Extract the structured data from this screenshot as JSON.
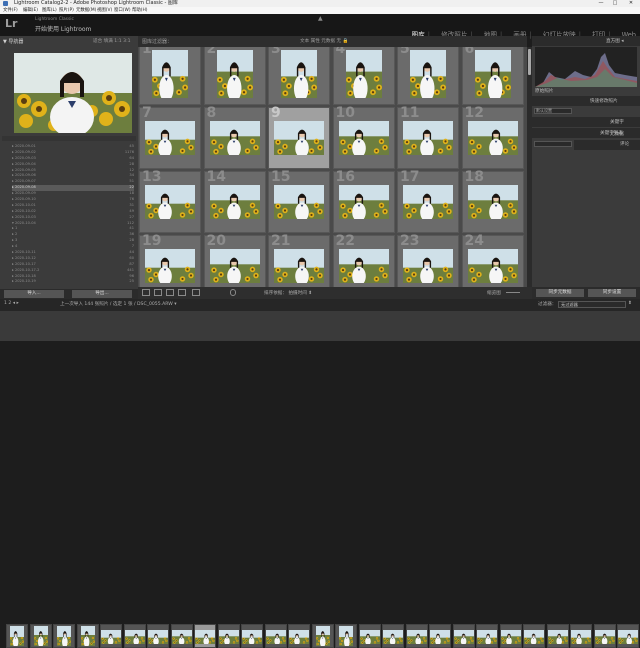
{
  "window": {
    "title": "Lightroom Catalog2-2 - Adobe Photoshop Lightroom Classic - 图库",
    "minimize": "—",
    "maximize": "□",
    "close": "✕"
  },
  "menu": [
    "文件(F)",
    "编辑(E)",
    "图库(L)",
    "照片(P)",
    "元数据(M)",
    "视图(V)",
    "窗口(W)",
    "帮助(H)"
  ],
  "identity": {
    "logo": "Lr",
    "catalog": "Lightroom Classic",
    "plate": "开始使用 Lightroom",
    "arrow": "▲"
  },
  "modules": [
    "图库",
    "修改照片",
    "地图",
    "画册",
    "幻灯片放映",
    "打印",
    "Web"
  ],
  "active_module": "图库",
  "left_panel": {
    "navigator_title": "▼ 导航器",
    "view_options": "适合  填满  1:1  3:1",
    "folders": [
      {
        "name": "▸ 2020-09-01",
        "count": "45"
      },
      {
        "name": "▸ 2020-09-02",
        "count": "1176"
      },
      {
        "name": "▸ 2020-09-03",
        "count": "64"
      },
      {
        "name": "▸ 2020-09-04",
        "count": "28"
      },
      {
        "name": "▸ 2020-09-05",
        "count": "12"
      },
      {
        "name": "▸ 2020-09-06",
        "count": "34"
      },
      {
        "name": "▸ 2020-09-07",
        "count": "51"
      },
      {
        "name": "▸ 2020-09-08",
        "count": "22"
      },
      {
        "name": "▸ 2020-09-09",
        "count": "18"
      },
      {
        "name": "▸ 2020-09-10",
        "count": "76"
      },
      {
        "name": "▸ 2020-10-01",
        "count": "31"
      },
      {
        "name": "▸ 2020-10-02",
        "count": "49"
      },
      {
        "name": "▸ 2020-10-03",
        "count": "27"
      },
      {
        "name": "▾ 2020-10-04",
        "count": "112"
      },
      {
        "name": "   ▸ 1",
        "count": "41"
      },
      {
        "name": "   ▸ 2",
        "count": "36"
      },
      {
        "name": "   ▸ 3",
        "count": "28"
      },
      {
        "name": "   ▸ 4",
        "count": "7"
      },
      {
        "name": "▸ 2020-10-11",
        "count": "44"
      },
      {
        "name": "▸ 2020-10-12",
        "count": "60"
      },
      {
        "name": "▸ 2020-10-17",
        "count": "87"
      },
      {
        "name": "▸ 2020-10-17-2",
        "count": "441"
      },
      {
        "name": "▸ 2020-10-18",
        "count": "96"
      },
      {
        "name": "▸ 2020-10-19",
        "count": "25"
      }
    ],
    "selected_folder_index": 7,
    "import_button": "导入...",
    "export_button": "导出..."
  },
  "toolbar_top": {
    "filter_title": "图库过滤器：",
    "options": "文本   属性   元数据   无  🔒"
  },
  "grid": {
    "numbers": [
      "1",
      "2",
      "3",
      "4",
      "5",
      "6",
      "7",
      "8",
      "9",
      "10",
      "11",
      "12",
      "13",
      "14",
      "15",
      "16",
      "17",
      "18",
      "19",
      "20",
      "21",
      "22",
      "23",
      "24"
    ],
    "selected_index": 8
  },
  "right_panel": {
    "histogram_title": "直方图 ◂",
    "quick_develop": "快速修改照片",
    "preset": "默认设置",
    "keywords": "关键字",
    "keyword_list": "关键字列表",
    "metadata": "元数据",
    "comments": "评论",
    "sync_metadata": "同步元数据",
    "sync_settings": "同步设置",
    "raw_label": "原始照片"
  },
  "bottom_toolbar": {
    "sort_label": "排序依据：",
    "sort_value": "拍摄时间 ⬍",
    "thumbs_label": "缩览图"
  },
  "filmstrip_bar": {
    "nav": "1   2   ◂  ▸",
    "source": "上一次导入  144 张照片 / 选定 1 张 / DSC_0055.ARW ▾",
    "filter_label": "过滤器：",
    "filter_value": "无过滤器",
    "filter_end": "⬍"
  },
  "colors": {
    "accent": "#eeeeee",
    "grid_bg": "#4a4a4a",
    "panel_bg": "#3b3b3b",
    "sunflower": "#e0b21a",
    "sky": "#cfe0e8"
  }
}
